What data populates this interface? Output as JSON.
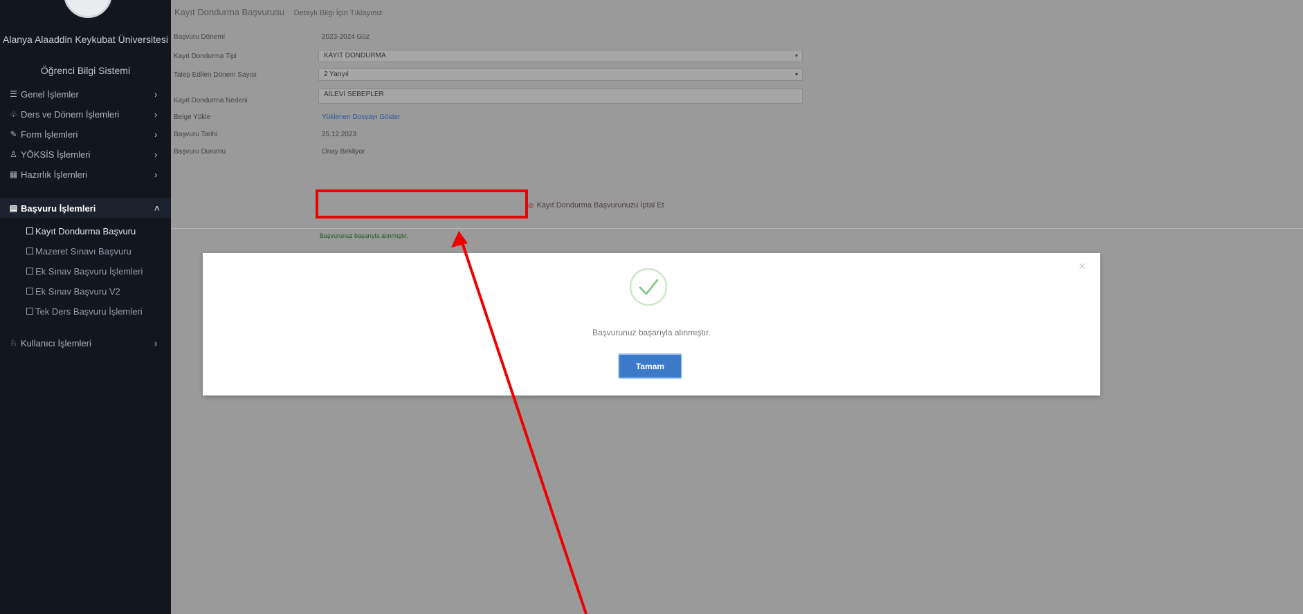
{
  "sidebar": {
    "university": "Alanya Alaaddin Keykubat Üniversitesi",
    "system": "Öğrenci Bilgi Sistemi",
    "items": [
      {
        "label": "Genel İşlemler",
        "icon": "list-icon"
      },
      {
        "label": "Ders ve Dönem İşlemleri",
        "icon": "sitemap-icon"
      },
      {
        "label": "Form İşlemleri",
        "icon": "edit-icon"
      },
      {
        "label": "YÖKSİS İşlemleri",
        "icon": "users-icon"
      },
      {
        "label": "Hazırlık İşlemleri",
        "icon": "grid-icon"
      },
      {
        "label": "Başvuru İşlemleri",
        "icon": "file-icon"
      }
    ],
    "subitems": [
      "Kayıt Dondurma Başvuru",
      "Mazeret Sınavı Başvuru",
      "Ek Sınav Başvuru İşlemleri",
      "Ek Sınav Başvuru V2",
      "Tek Ders Başvuru İşlemleri"
    ],
    "last": {
      "label": "Kullanıcı İşlemleri",
      "icon": "user-icon"
    }
  },
  "breadcrumb": {
    "title": "Kayıt Dondurma Başvurusu",
    "subtitle": "Detaylı Bilgi İçin Tıklayınız"
  },
  "form": {
    "donem_label": "Başvuru Dönemi",
    "donem_value": "2023-2024 Güz",
    "tip_label": "Kayıt Dondurma Tipi",
    "tip_value": "KAYIT DONDURMA",
    "sayisi_label": "Talep Edilen Dönem Sayısı",
    "sayisi_value": "2 Yarıyıl",
    "neden_label": "Kayıt Dondurma Nedeni",
    "neden_value": "AİLEVİ SEBEPLER",
    "belge_label": "Belge Yükle",
    "belge_value": "Yüklenen Dosyayı Göster",
    "tarih_label": "Başvuru Tarihi",
    "tarih_value": "25.12.2023",
    "durum_label": "Başvuru Durumu",
    "durum_value": "Onay Bekliyor",
    "cancel_button": "Kayıt Dondurma Başvurunuzu İptal Et",
    "success_small": "Başvurunuz başarıyla alınmıştır."
  },
  "modal": {
    "message": "Başvurunuz başarıyla alınmıştır.",
    "ok": "Tamam",
    "close": "×"
  },
  "colors": {
    "sidebar_bg": "#12161f",
    "overlay": "#9a9a9a",
    "primary": "#3c7ac9",
    "success": "#8cc98c",
    "highlight": "#ee0000"
  }
}
